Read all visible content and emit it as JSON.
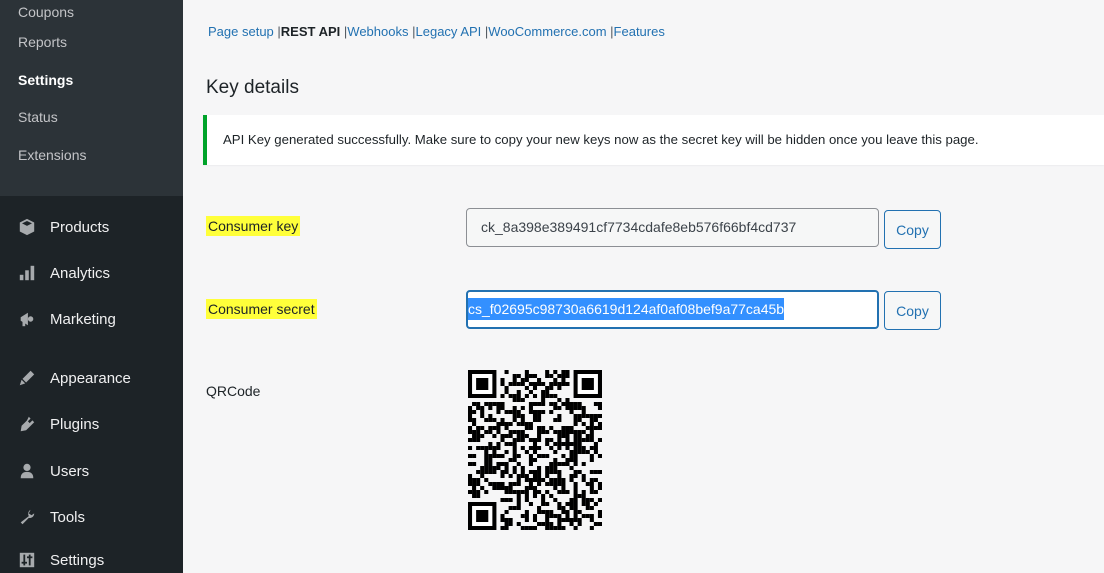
{
  "sidebar": {
    "submenu": [
      {
        "label": "Coupons",
        "current": false
      },
      {
        "label": "Reports",
        "current": false
      },
      {
        "label": "Settings",
        "current": true
      },
      {
        "label": "Status",
        "current": false
      },
      {
        "label": "Extensions",
        "current": false
      }
    ],
    "menu": [
      {
        "label": "Products",
        "icon": "products-icon"
      },
      {
        "label": "Analytics",
        "icon": "analytics-icon"
      },
      {
        "label": "Marketing",
        "icon": "marketing-icon"
      },
      {
        "label": "Appearance",
        "icon": "appearance-icon"
      },
      {
        "label": "Plugins",
        "icon": "plugins-icon"
      },
      {
        "label": "Users",
        "icon": "users-icon"
      },
      {
        "label": "Tools",
        "icon": "tools-icon"
      },
      {
        "label": "Settings",
        "icon": "settings-icon"
      }
    ]
  },
  "tabs": {
    "page_setup": "Page setup",
    "rest_api": "REST API",
    "webhooks": "Webhooks",
    "legacy_api": "Legacy API",
    "woocommerce": "WooCommerce.com",
    "features": "Features",
    "separator": "|"
  },
  "main": {
    "title": "Key details",
    "notice": "API Key generated successfully. Make sure to copy your new keys now as the secret key will be hidden once you leave this page.",
    "consumer_key_label": "Consumer key",
    "consumer_key_value": "ck_8a398e389491cf7734cdafe8eb576f66bf4cd737",
    "consumer_secret_label": "Consumer secret",
    "consumer_secret_value": "cs_f02695c98730a6619d124af0af08bef9a77ca45b",
    "copy_label": "Copy",
    "qr_label": "QRCode"
  },
  "colors": {
    "sidebar_bg": "#1d2327",
    "submenu_bg": "#2c3338",
    "link": "#2271b1",
    "notice_border": "#00a32a",
    "highlight": "#ffff3a",
    "selection": "#3390ff"
  }
}
